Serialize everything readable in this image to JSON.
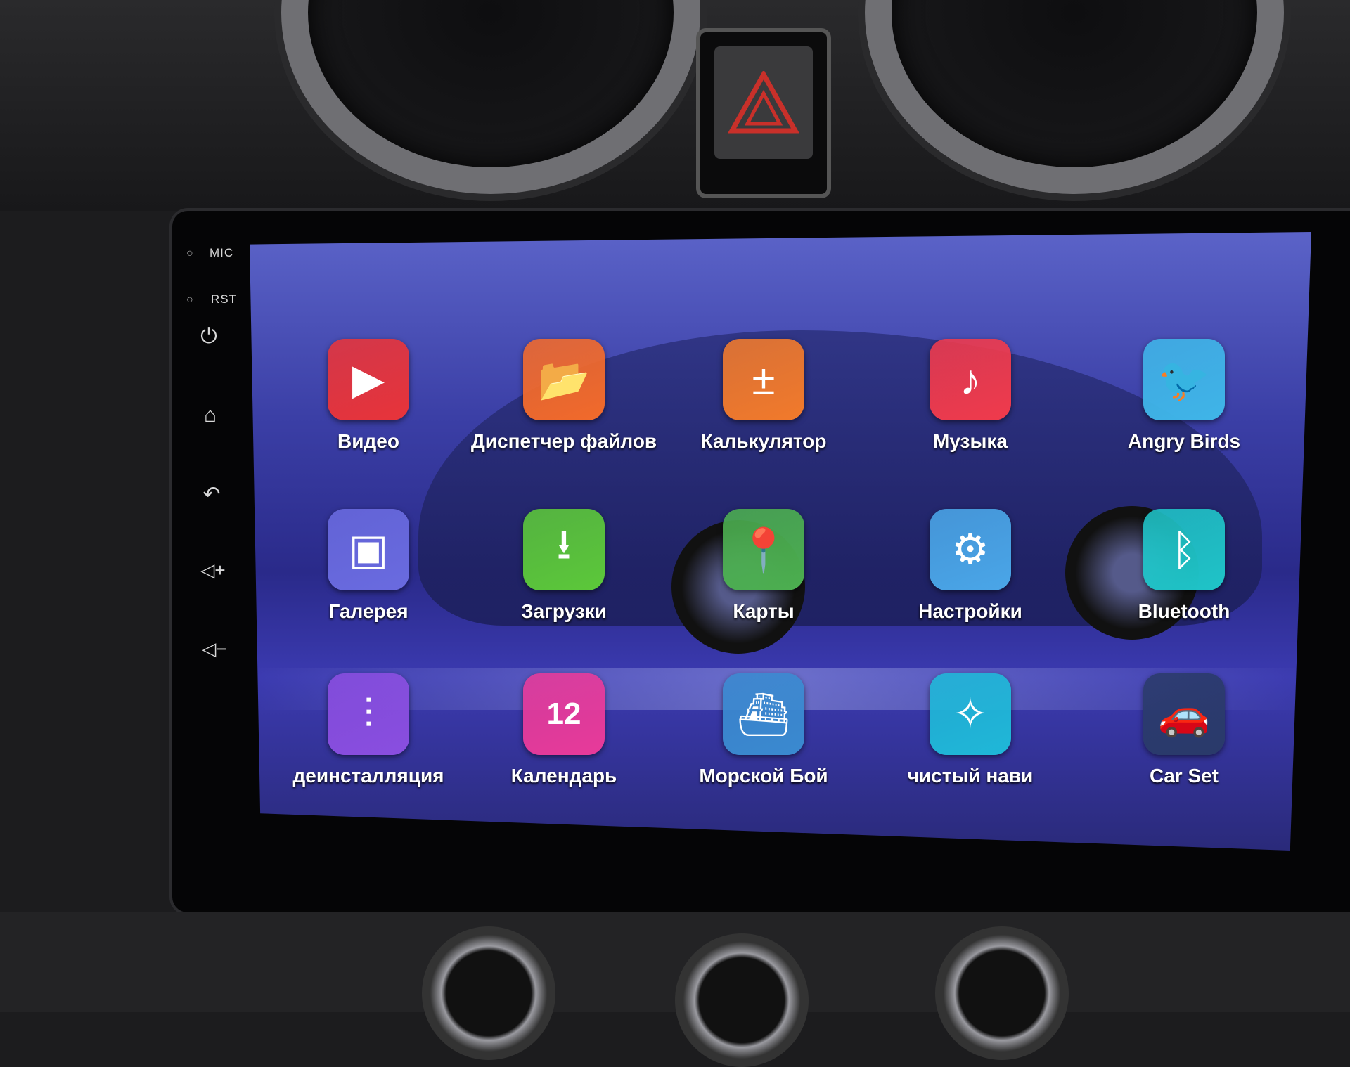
{
  "bezel": {
    "mic_label": "MIC",
    "rst_label": "RST",
    "buttons": [
      {
        "icon": "power-icon"
      },
      {
        "icon": "home-icon"
      },
      {
        "icon": "back-icon"
      },
      {
        "icon": "volume-up-icon"
      },
      {
        "icon": "volume-down-icon"
      }
    ]
  },
  "apps": [
    {
      "label": "Видео",
      "icon": "video-play-icon",
      "color": "#e8343a"
    },
    {
      "label": "Диспетчер файлов",
      "icon": "folder-icon",
      "color": "#f26a2b"
    },
    {
      "label": "Калькулятор",
      "icon": "calculator-icon",
      "color": "#f27a2b"
    },
    {
      "label": "Музыка",
      "icon": "music-note-icon",
      "color": "#f03a4c"
    },
    {
      "label": "Angry Birds",
      "icon": "angry-birds-icon",
      "color": "#3fb5e8"
    },
    {
      "label": "Галерея",
      "icon": "gallery-icon",
      "color": "#6a6be0"
    },
    {
      "label": "Загрузки",
      "icon": "download-icon",
      "color": "#5cc83a"
    },
    {
      "label": "Карты",
      "icon": "maps-icon",
      "color": "#4caf50"
    },
    {
      "label": "Настройки",
      "icon": "settings-gear-icon",
      "color": "#4aa6e8"
    },
    {
      "label": "Bluetooth",
      "icon": "bluetooth-icon",
      "color": "#1fc4c8"
    },
    {
      "label": "деинсталляция",
      "icon": "uninstall-sliders-icon",
      "color": "#8a4ee0"
    },
    {
      "label": "Календарь",
      "icon": "calendar-icon",
      "color": "#e83a9a"
    },
    {
      "label": "Морской Бой",
      "icon": "battleship-icon",
      "color": "#3a8ad0"
    },
    {
      "label": "чистый нави",
      "icon": "compass-icon",
      "color": "#1fb8d8"
    },
    {
      "label": "Car Set",
      "icon": "car-settings-icon",
      "color": "#2a3a6a"
    }
  ]
}
